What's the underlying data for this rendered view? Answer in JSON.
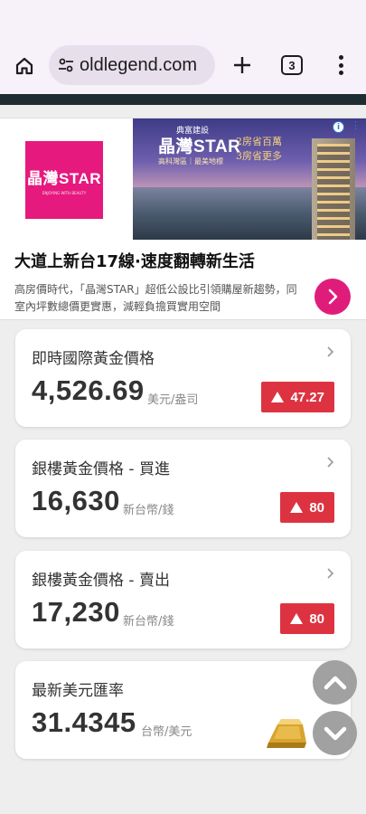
{
  "browser": {
    "url": "oldlegend.com",
    "tab_count": "3"
  },
  "ad": {
    "logo_text": "晶灣STAR",
    "logo_sub": "ENJOYING WITH BEAUTY",
    "image_brand": "典富建設",
    "image_title": "晶灣STAR",
    "image_subtitle": "高科灣區｜最美地標",
    "offer_line1": "2房省百萬",
    "offer_line2": "3房省更多",
    "headline": "大道上新台17線·速度翻轉新生活",
    "description": "高房價時代，「晶灣STAR」超低公設比引領購屋新趨勢，同室內坪數總價更實惠，減輕負擔買實用空間",
    "info_icon": "i",
    "close_icon": "⋮"
  },
  "prices": [
    {
      "title": "即時國際黃金價格",
      "value": "4,526.69",
      "unit": "美元/盎司",
      "change": "47.27",
      "direction": "up"
    },
    {
      "title": "銀樓黃金價格 - 買進",
      "value": "16,630",
      "unit": "新台幣/錢",
      "change": "80",
      "direction": "up"
    },
    {
      "title": "銀樓黃金價格 - 賣出",
      "value": "17,230",
      "unit": "新台幣/錢",
      "change": "80",
      "direction": "up"
    },
    {
      "title": "最新美元匯率",
      "value": "31.4345",
      "unit": "台幣/美元"
    }
  ],
  "colors": {
    "up_badge": "#dd3341",
    "ad_accent": "#e6197e",
    "header_bar": "#1e2d32"
  }
}
